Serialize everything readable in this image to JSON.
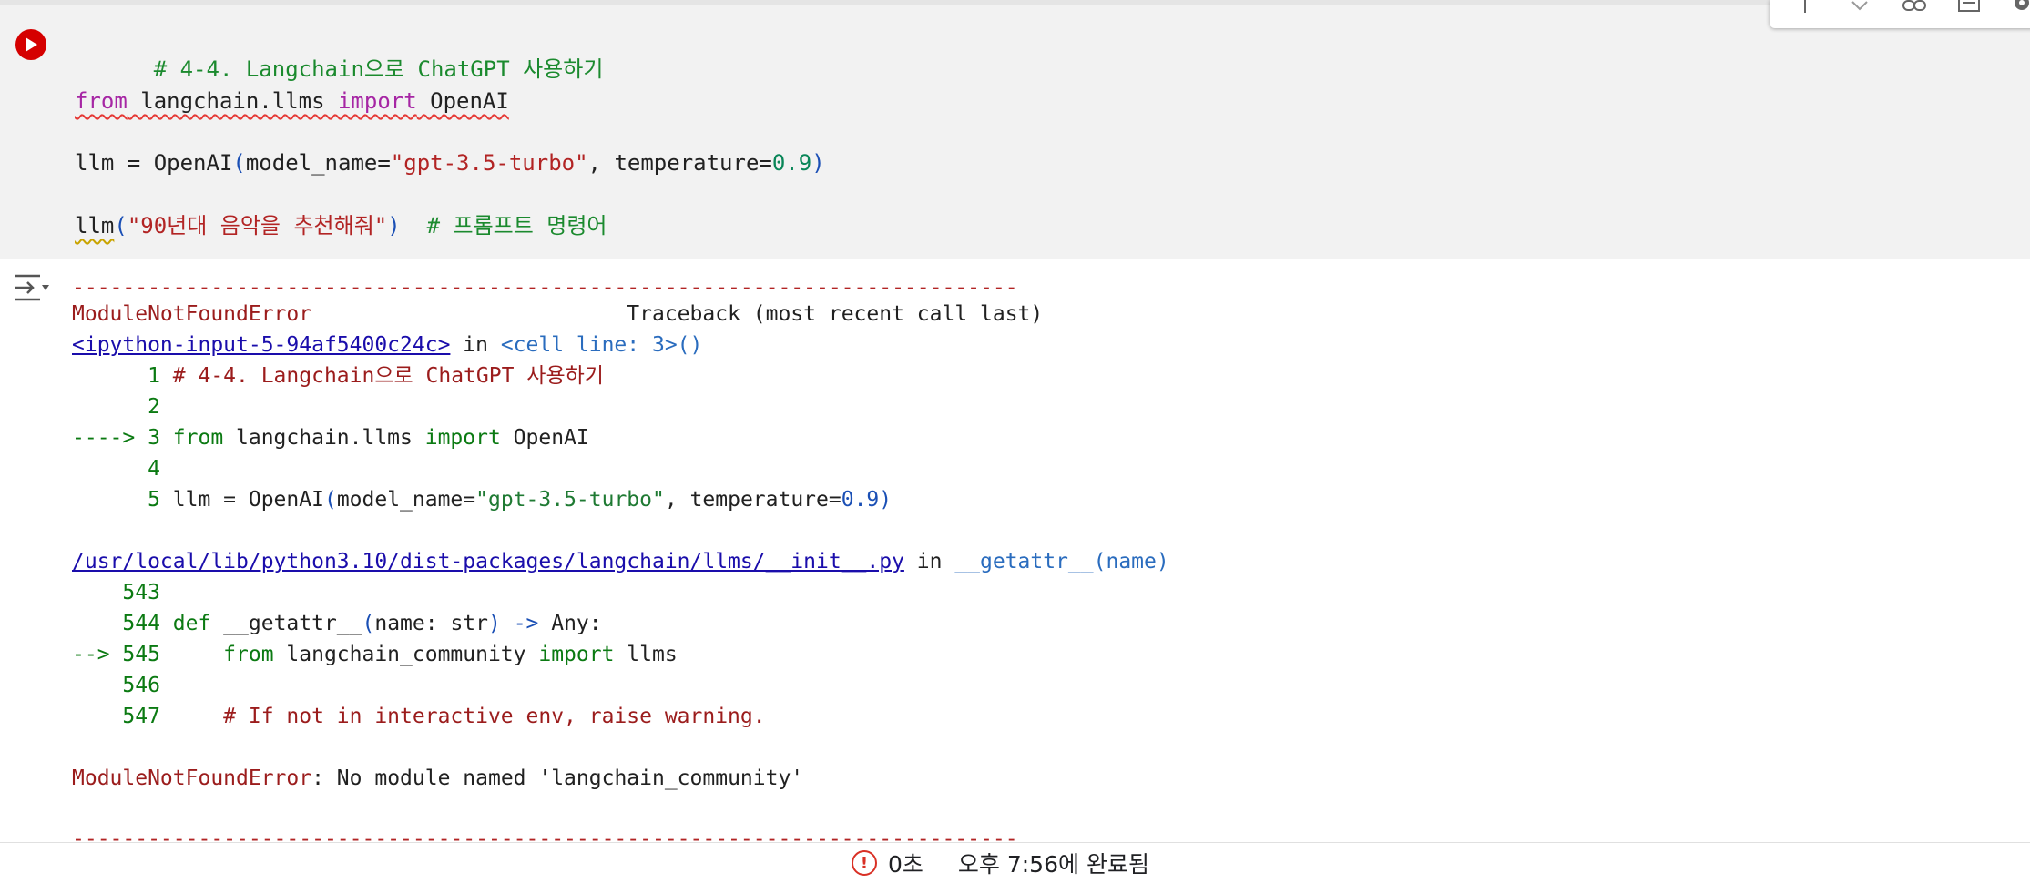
{
  "cell": {
    "run_icon": "play-icon",
    "lines": {
      "l1": "# 4-4. Langchain으로 ChatGPT 사용하기",
      "l2_from": "from",
      "l2_mod": " langchain.llms ",
      "l2_import": "import",
      "l2_name": " OpenAI",
      "l3_var": "llm = OpenAI",
      "l3_open": "(",
      "l3_arg1": "model_name=",
      "l3_str": "\"gpt-3.5-turbo\"",
      "l3_mid": ", temperature=",
      "l3_num": "0.9",
      "l3_close": ")",
      "l4_fn": "llm",
      "l4_open": "(",
      "l4_str": "\"90년대 음악을 추천해줘\"",
      "l4_close": ")",
      "l4_comment": "  # 프롬프트 명령어"
    }
  },
  "toolbar": {
    "icons": [
      "arrow-up-icon",
      "arrow-down-icon",
      "link-icon",
      "comment-icon",
      "gear-icon"
    ]
  },
  "output": {
    "icon": "output-options-icon",
    "dashes": "---------------------------------------------------------------------------",
    "error_name": "ModuleNotFoundError",
    "traceback_label": "                         Traceback (most recent call last)",
    "frame1_link": "<ipython-input-5-94af5400c24c>",
    "frame1_in": " in ",
    "frame1_loc": "<cell line: 3>()",
    "f1_1_no": "      1 ",
    "f1_1_text": "# 4-4. Langchain으로 ChatGPT 사용하기",
    "f1_2_no": "      2",
    "f1_3_arrow": "----> 3 ",
    "f1_3_from": "from",
    "f1_3_mod": " langchain.llms ",
    "f1_3_import": "import",
    "f1_3_name": " OpenAI",
    "f1_4_no": "      4",
    "f1_5_no": "      5 ",
    "f1_5_var": "llm = OpenAI",
    "f1_5_open": "(",
    "f1_5_arg": "model_name=",
    "f1_5_str": "\"gpt-3.5-turbo\"",
    "f1_5_mid": ", temperature=",
    "f1_5_num": "0.9",
    "f1_5_close": ")",
    "frame2_link": "/usr/local/lib/python3.10/dist-packages/langchain/llms/__init__.py",
    "frame2_in": " in ",
    "frame2_loc": "__getattr__(name)",
    "f2_543": "    543",
    "f2_544_no": "    544 ",
    "f2_544_def": "def",
    "f2_544_rest": " __getattr__",
    "f2_544_open": "(",
    "f2_544_args": "name: str",
    "f2_544_close": ")",
    "f2_544_arrow": " ->",
    "f2_544_ret": " Any:",
    "f2_545_arrow": "--> 545 ",
    "f2_545_from": "    from",
    "f2_545_mod": " langchain_community ",
    "f2_545_import": "import",
    "f2_545_name": " llms",
    "f2_546": "    546",
    "f2_547_no": "    547 ",
    "f2_547_comment": "    # If not in interactive env, raise warning.",
    "final_err_name": "ModuleNotFoundError",
    "final_err_msg": ": No module named 'langchain_community'",
    "dashes_bottom": "---------------------------------------------------------------------------"
  },
  "status": {
    "icon": "error-circle-icon",
    "icon_glyph": "!",
    "duration": "0초",
    "completed": "오후 7:56에 완료됨"
  }
}
